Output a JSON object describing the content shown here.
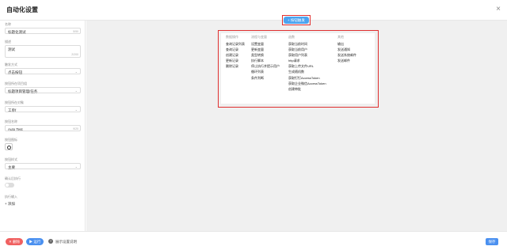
{
  "header": {
    "title": "自动化设置",
    "close_icon": "×"
  },
  "form": {
    "name_label": "名称",
    "name_value": "标题化测试",
    "name_count": "5/50",
    "desc_label": "描述",
    "desc_value": "测试",
    "desc_count": "2/200",
    "trigger_label": "触发方式",
    "trigger_value": "点击按钮",
    "project_label": "按钮所在项目组",
    "project_value": "标题项目管理/任务",
    "object_label": "按钮所在对象",
    "object_value": "工单f",
    "button_name_label": "按钮名称",
    "button_name_value": "Auto Test",
    "button_name_count": "9/20",
    "icon_label": "按钮图标",
    "style_label": "按钮样式",
    "style_value": "主要",
    "confirm_label": "确认后执行",
    "param_label": "执行输入",
    "add_label": "+ 添加"
  },
  "canvas": {
    "start_button": "+ 按钮触发",
    "columns": [
      {
        "header": "数据操作",
        "items": [
          "查询记录列表",
          "查询记录",
          "创建记录",
          "更新记录",
          "删除记录"
        ]
      },
      {
        "header": "流程与变量",
        "items": [
          "设置变量",
          "更新变量",
          "类型转换",
          "执行脚本",
          "停止执行并提示用户",
          "循环列表",
          "条件判断"
        ]
      },
      {
        "header": "函数",
        "items": [
          "获取当前时间",
          "获取当前用户",
          "获取用户列表",
          "http请求",
          "获取上传文件URL",
          "生成随机数",
          "获取钉钉AccessToken",
          "获取企业微信AccessToken",
          "创建审批"
        ]
      },
      {
        "header": "其他",
        "items": [
          "输出",
          "发送通知",
          "发送系统邮件",
          "发送邮件"
        ]
      }
    ]
  },
  "footer": {
    "delete_label": "✕ 删除",
    "run_label": "▶ 运行",
    "help_icon": "?",
    "help_text": "展示设置说明",
    "save_label": "保存"
  },
  "colors": {
    "accent": "#4a90f0",
    "danger": "#f06060",
    "highlight": "#e03030"
  }
}
